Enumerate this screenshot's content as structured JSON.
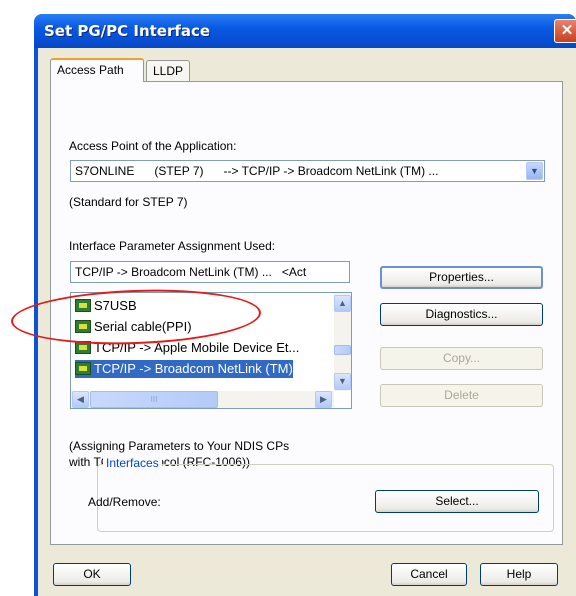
{
  "window": {
    "title": "Set PG/PC Interface",
    "close_glyph": "✕"
  },
  "tabs": [
    {
      "label": "Access Path",
      "active": true
    },
    {
      "label": "LLDP",
      "active": false
    }
  ],
  "access_point": {
    "label": "Access Point of the Application:",
    "value": "S7ONLINE      (STEP 7)      --> TCP/IP -> Broadcom NetLink (TM) ...",
    "note": "(Standard for STEP 7)"
  },
  "interface_param": {
    "label": "Interface Parameter Assignment Used:",
    "value": "TCP/IP -> Broadcom NetLink (TM) ...   <Act"
  },
  "list": {
    "items": [
      {
        "label": "S7USB",
        "icon": "network-card-icon"
      },
      {
        "label": "Serial cable(PPI)",
        "icon": "network-card-icon"
      },
      {
        "label": "TCP/IP -> Apple Mobile Device Et...",
        "icon": "network-card-icon"
      },
      {
        "label": "TCP/IP -> Broadcom NetLink (TM)",
        "icon": "network-card-icon"
      }
    ],
    "scroll_up_glyph": "▲",
    "scroll_down_glyph": "▼",
    "scroll_left_glyph": "◀",
    "scroll_right_glyph": "▶",
    "thumb_grip_glyph": "III"
  },
  "buttons": {
    "properties": "Properties...",
    "diagnostics": "Diagnostics...",
    "copy": "Copy...",
    "delete": "Delete",
    "select": "Select...",
    "ok": "OK",
    "cancel": "Cancel",
    "help": "Help"
  },
  "description": {
    "line1": "(Assigning Parameters to Your NDIS CPs",
    "line2": "with TCP/IP Protocol (RFC-1006))"
  },
  "interfaces": {
    "title": "Interfaces",
    "add_remove_label": "Add/Remove:"
  },
  "colors": {
    "titlebar": "#0a5ae3",
    "annotation": "#e41b1b",
    "selection": "#316ac5"
  },
  "combo_arrow_glyph": "▼"
}
